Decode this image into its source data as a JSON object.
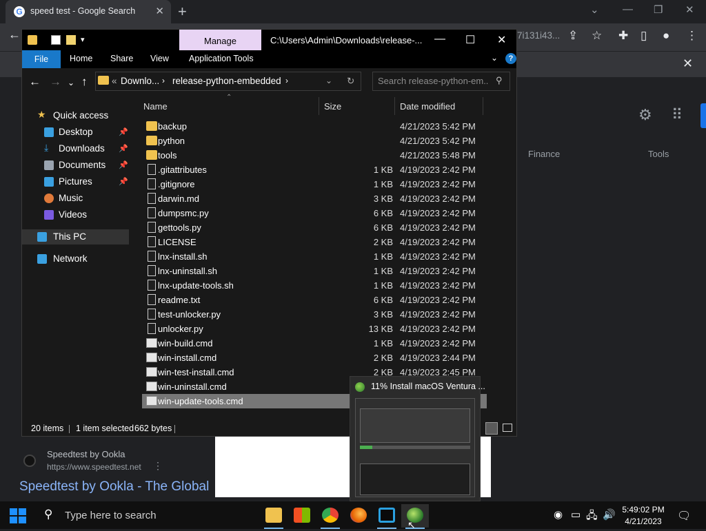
{
  "chrome": {
    "tab_title": "speed test - Google Search",
    "new_tab": "+",
    "url_fragment": "7i131i43...",
    "google_tabs": {
      "finance": "Finance",
      "tools": "Tools"
    },
    "result": {
      "site": "Speedtest by Ookla",
      "url": "https://www.speedtest.net",
      "title": "Speedtest by Ookla - The Global"
    }
  },
  "explorer": {
    "ribbon_context_tab": "Manage",
    "title": "C:\\Users\\Admin\\Downloads\\release-...",
    "ribbon_tabs": {
      "file": "File",
      "home": "Home",
      "share": "Share",
      "view": "View",
      "application_tools": "Application Tools"
    },
    "help": "?",
    "address": {
      "prefix": "«",
      "part1": "Downlo...",
      "part2": "release-python-embedded"
    },
    "search": {
      "placeholder": "Search release-python-em..."
    },
    "nav_pane": {
      "quick_access": "Quick access",
      "desktop": "Desktop",
      "downloads": "Downloads",
      "documents": "Documents",
      "pictures": "Pictures",
      "music": "Music",
      "videos": "Videos",
      "this_pc": "This PC",
      "network": "Network"
    },
    "columns": {
      "name": "Name",
      "size": "Size",
      "date": "Date modified"
    },
    "files": [
      {
        "name": "backup",
        "size": "",
        "date": "4/21/2023 5:42 PM",
        "type": "folder"
      },
      {
        "name": "python",
        "size": "",
        "date": "4/21/2023 5:42 PM",
        "type": "folder"
      },
      {
        "name": "tools",
        "size": "",
        "date": "4/21/2023 5:48 PM",
        "type": "folder"
      },
      {
        "name": ".gitattributes",
        "size": "1 KB",
        "date": "4/19/2023 2:42 PM",
        "type": "doc"
      },
      {
        "name": ".gitignore",
        "size": "1 KB",
        "date": "4/19/2023 2:42 PM",
        "type": "doc"
      },
      {
        "name": "darwin.md",
        "size": "3 KB",
        "date": "4/19/2023 2:42 PM",
        "type": "doc"
      },
      {
        "name": "dumpsmc.py",
        "size": "6 KB",
        "date": "4/19/2023 2:42 PM",
        "type": "doc"
      },
      {
        "name": "gettools.py",
        "size": "6 KB",
        "date": "4/19/2023 2:42 PM",
        "type": "doc"
      },
      {
        "name": "LICENSE",
        "size": "2 KB",
        "date": "4/19/2023 2:42 PM",
        "type": "doc"
      },
      {
        "name": "lnx-install.sh",
        "size": "1 KB",
        "date": "4/19/2023 2:42 PM",
        "type": "doc"
      },
      {
        "name": "lnx-uninstall.sh",
        "size": "1 KB",
        "date": "4/19/2023 2:42 PM",
        "type": "doc"
      },
      {
        "name": "lnx-update-tools.sh",
        "size": "1 KB",
        "date": "4/19/2023 2:42 PM",
        "type": "doc"
      },
      {
        "name": "readme.txt",
        "size": "6 KB",
        "date": "4/19/2023 2:42 PM",
        "type": "doc"
      },
      {
        "name": "test-unlocker.py",
        "size": "3 KB",
        "date": "4/19/2023 2:42 PM",
        "type": "doc"
      },
      {
        "name": "unlocker.py",
        "size": "13 KB",
        "date": "4/19/2023 2:42 PM",
        "type": "doc"
      },
      {
        "name": "win-build.cmd",
        "size": "1 KB",
        "date": "4/19/2023 2:42 PM",
        "type": "cmd"
      },
      {
        "name": "win-install.cmd",
        "size": "2 KB",
        "date": "4/19/2023 2:44 PM",
        "type": "cmd"
      },
      {
        "name": "win-test-install.cmd",
        "size": "2 KB",
        "date": "4/19/2023 2:45 PM",
        "type": "cmd"
      },
      {
        "name": "win-uninstall.cmd",
        "size": "",
        "date": "",
        "type": "cmd"
      },
      {
        "name": "win-update-tools.cmd",
        "size": "",
        "date": "",
        "type": "cmd",
        "selected": true
      }
    ],
    "status": {
      "count": "20 items",
      "selected": "1 item selected",
      "size": "662 bytes"
    }
  },
  "thumbnail": {
    "title": "11% Install macOS Ventura ..."
  },
  "taskbar": {
    "search_placeholder": "Type here to search",
    "time": "5:49:02 PM",
    "date": "4/21/2023"
  }
}
